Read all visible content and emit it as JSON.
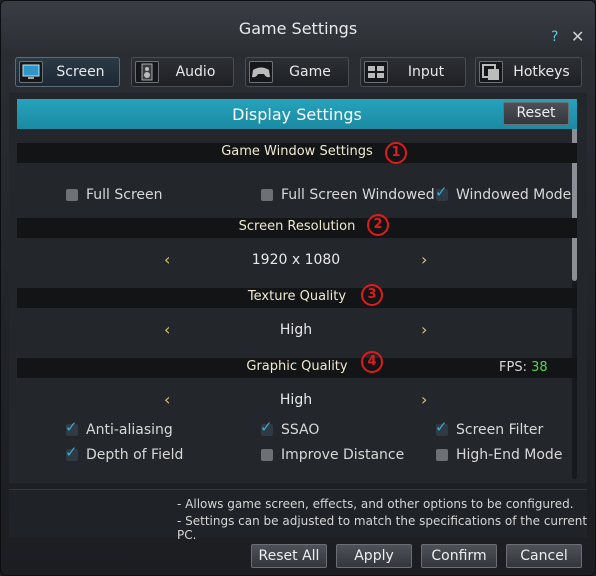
{
  "window": {
    "title": "Game Settings",
    "help": "?",
    "close": "✕"
  },
  "tabs": [
    {
      "label": "Screen"
    },
    {
      "label": "Audio"
    },
    {
      "label": "Game"
    },
    {
      "label": "Input"
    },
    {
      "label": "Hotkeys"
    }
  ],
  "display": {
    "title": "Display Settings",
    "reset": "Reset"
  },
  "sections": {
    "window": {
      "title": "Game Window Settings",
      "badge": "1"
    },
    "resolution": {
      "title": "Screen Resolution",
      "badge": "2",
      "value": "1920 x 1080"
    },
    "texture": {
      "title": "Texture Quality",
      "badge": "3",
      "value": "High"
    },
    "graphic": {
      "title": "Graphic Quality",
      "badge": "4",
      "value": "High"
    }
  },
  "window_modes": [
    {
      "label": "Full Screen",
      "checked": false
    },
    {
      "label": "Full Screen Windowed",
      "checked": false
    },
    {
      "label": "Windowed Mode",
      "checked": true
    }
  ],
  "graphic_options": [
    {
      "label": "Anti-aliasing",
      "checked": true
    },
    {
      "label": "SSAO",
      "checked": true
    },
    {
      "label": "Screen Filter",
      "checked": true
    },
    {
      "label": "Depth of Field",
      "checked": true
    },
    {
      "label": "Improve Distance",
      "checked": false
    },
    {
      "label": "High-End Mode",
      "checked": false
    }
  ],
  "fps": {
    "label": "FPS:",
    "value": "38"
  },
  "info": [
    "- Allows game screen, effects, and other options to be configured.",
    "- Settings can be adjusted to match the specifications of the current PC."
  ],
  "buttons": {
    "reset_all": "Reset All",
    "apply": "Apply",
    "confirm": "Confirm",
    "cancel": "Cancel"
  },
  "colors": {
    "accent": "#1f94ae",
    "badge": "#e01b1b",
    "fps": "#55d455",
    "check": "#3fa7d1",
    "arrow": "#e0c06a"
  },
  "icons": {
    "left_arrow": "‹",
    "right_arrow": "›",
    "check": "✓",
    "tabs": [
      "monitor-icon",
      "speaker-icon",
      "gamepad-icon",
      "keyboard-icon",
      "hotkeys-icon"
    ]
  }
}
